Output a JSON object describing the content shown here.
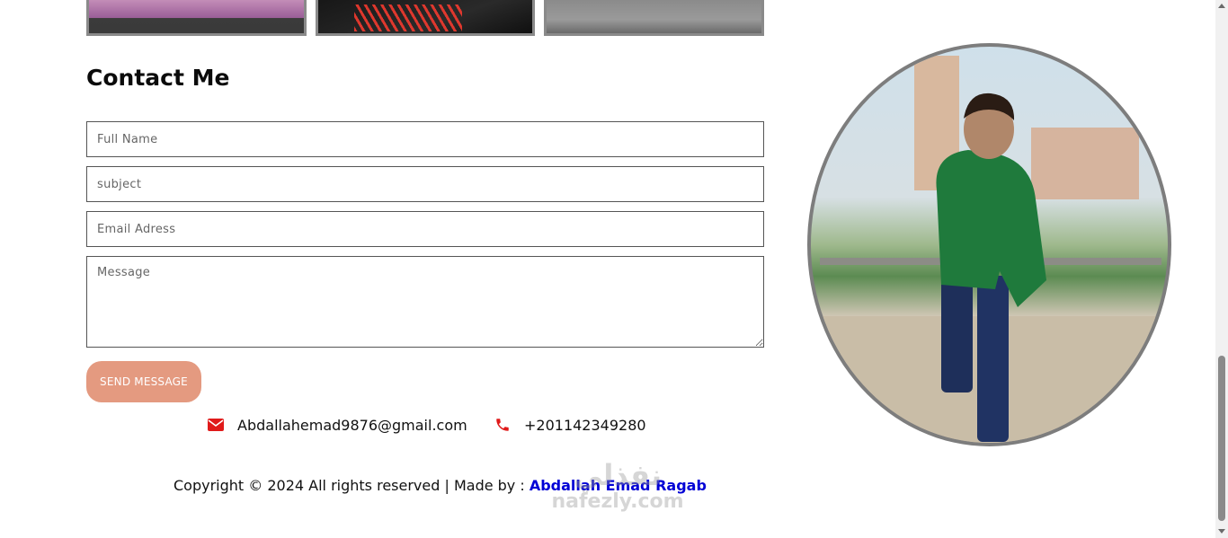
{
  "gallery": {
    "items": [
      "desk-setup",
      "laptop-keyboard",
      "monitor"
    ]
  },
  "contact": {
    "heading": "Contact Me",
    "form": {
      "full_name_placeholder": "Full Name",
      "subject_placeholder": "subject",
      "email_placeholder": "Email Adress",
      "message_placeholder": "Message",
      "send_label": "SEND MESSAGE"
    },
    "email": "Abdallahemad9876@gmail.com",
    "phone": "+201142349280",
    "email_icon": "envelope-icon",
    "phone_icon": "phone-icon",
    "icon_color": "#e01a1a"
  },
  "footer": {
    "copyright": "Copyright © 2024 All rights reserved | Made by : ",
    "author": "Abdallah Emad Ragab",
    "author_color": "#0000d6"
  },
  "watermark": {
    "arabic": "نفذلي",
    "latin": "nafezly.com"
  },
  "portrait": {
    "alt": "profile photo"
  },
  "colors": {
    "accent_button": "#e49a80",
    "frame": "#7d7d7d"
  }
}
